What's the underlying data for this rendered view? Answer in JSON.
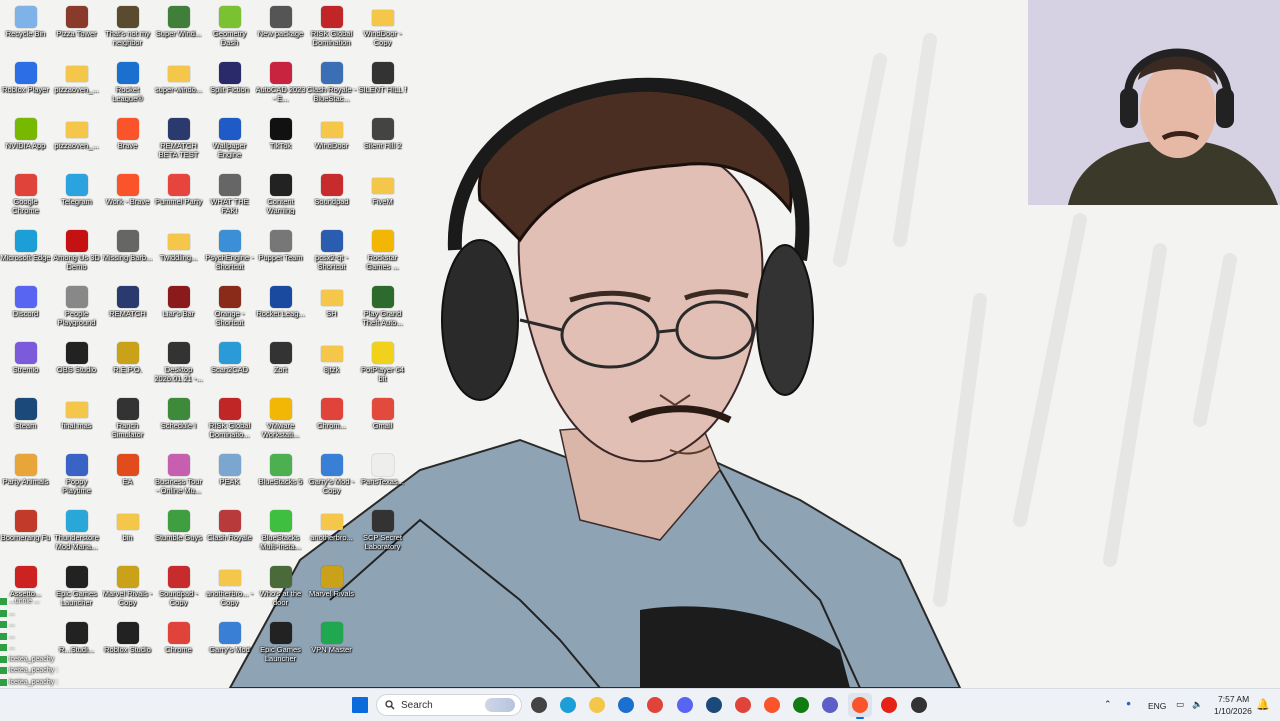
{
  "desktop": {
    "icons": [
      {
        "label": "Recycle Bin",
        "icon": "recycle-bin-icon",
        "color": "#7fb2e6"
      },
      {
        "label": "Pizza Tower",
        "icon": "pizza-tower-icon",
        "color": "#8a3a2a"
      },
      {
        "label": "That's not my neighbor",
        "icon": "neighbor-game-icon",
        "color": "#5a4a2e"
      },
      {
        "label": "Super Wind...",
        "icon": "game-icon",
        "color": "#3f7f3a"
      },
      {
        "label": "Geometry Dash",
        "icon": "geometry-dash-icon",
        "color": "#7ac231"
      },
      {
        "label": "New package",
        "icon": "package-icon",
        "color": "#555"
      },
      {
        "label": "RISK Global Domination",
        "icon": "risk-icon",
        "color": "#c02626"
      },
      {
        "label": "WindDoor - Copy",
        "icon": "folder-icon",
        "color": "#f4c64a",
        "folder": true
      },
      {
        "label": "Roblox Player",
        "icon": "roblox-icon",
        "color": "#2b6ee6"
      },
      {
        "label": "pizzaoven_...",
        "icon": "folder-icon",
        "color": "#f4c64a",
        "folder": true
      },
      {
        "label": "Rocket League®",
        "icon": "rocket-league-icon",
        "color": "#1a6fcf"
      },
      {
        "label": "super-windo...",
        "icon": "folder-icon",
        "color": "#f4c64a",
        "folder": true
      },
      {
        "label": "Split Fiction",
        "icon": "split-fiction-icon",
        "color": "#2a2a6a"
      },
      {
        "label": "AutoCAD 2023 - E...",
        "icon": "autocad-icon",
        "color": "#c9243f"
      },
      {
        "label": "Clash Royale - BlueStac...",
        "icon": "clash-royale-icon",
        "color": "#3b6fb5"
      },
      {
        "label": "SILENT HILL f",
        "icon": "silent-hill-icon",
        "color": "#333"
      },
      {
        "label": "NVIDIA App",
        "icon": "nvidia-icon",
        "color": "#76b900"
      },
      {
        "label": "pizzaoven_...",
        "icon": "folder-icon",
        "color": "#f4c64a",
        "folder": true
      },
      {
        "label": "Brave",
        "icon": "brave-icon",
        "color": "#fb542b"
      },
      {
        "label": "REMATCH BETA TEST",
        "icon": "rematch-icon",
        "color": "#2b3a6e"
      },
      {
        "label": "Wallpaper Engine",
        "icon": "wallpaper-engine-icon",
        "color": "#1e5bc6"
      },
      {
        "label": "TikTok",
        "icon": "tiktok-icon",
        "color": "#111"
      },
      {
        "label": "WindDoor",
        "icon": "folder-icon",
        "color": "#f4c64a",
        "folder": true
      },
      {
        "label": "Silent Hill 2",
        "icon": "silent-hill-2-icon",
        "color": "#444"
      },
      {
        "label": "Google Chrome",
        "icon": "chrome-icon",
        "color": "#e0433a"
      },
      {
        "label": "Telegram",
        "icon": "telegram-icon",
        "color": "#2aa3df"
      },
      {
        "label": "Work - Brave",
        "icon": "brave-work-icon",
        "color": "#fb542b"
      },
      {
        "label": "Pummel Party",
        "icon": "pummel-party-icon",
        "color": "#e7443e"
      },
      {
        "label": "WHAT THE FAK!",
        "icon": "game-icon",
        "color": "#666"
      },
      {
        "label": "Content Warning",
        "icon": "content-warning-icon",
        "color": "#222"
      },
      {
        "label": "Soundpad",
        "icon": "soundpad-icon",
        "color": "#c82b2b"
      },
      {
        "label": "FiveM",
        "icon": "folder-icon",
        "color": "#f4c64a",
        "folder": true
      },
      {
        "label": "Microsoft Edge",
        "icon": "edge-icon",
        "color": "#1b9fd6"
      },
      {
        "label": "Among Us 3D Demo",
        "icon": "among-us-icon",
        "color": "#c51111"
      },
      {
        "label": "Missing Barb...",
        "icon": "game-icon",
        "color": "#666"
      },
      {
        "label": "Twiddling...",
        "icon": "folder-icon",
        "color": "#f4c64a",
        "folder": true
      },
      {
        "label": "PsychEngine - Shortcut",
        "icon": "psych-engine-icon",
        "color": "#3a8fd6"
      },
      {
        "label": "Puppet Team",
        "icon": "game-icon",
        "color": "#777"
      },
      {
        "label": "pcsx2-qt - Shortcut",
        "icon": "pcsx2-icon",
        "color": "#2a5db0"
      },
      {
        "label": "Rockstar Games ...",
        "icon": "rockstar-icon",
        "color": "#f2b705"
      },
      {
        "label": "Discord",
        "icon": "discord-icon",
        "color": "#5865f2"
      },
      {
        "label": "People Playground",
        "icon": "people-playground-icon",
        "color": "#888"
      },
      {
        "label": "REMATCH",
        "icon": "rematch-icon",
        "color": "#2b3a6e"
      },
      {
        "label": "Liar's Bar",
        "icon": "liars-bar-icon",
        "color": "#8b1a1a"
      },
      {
        "label": "Orange - Shortcut",
        "icon": "orange-icon",
        "color": "#8a2b1a"
      },
      {
        "label": "Rocket Leag...",
        "icon": "rocket-league-icon",
        "color": "#1a4a9f"
      },
      {
        "label": "SH",
        "icon": "folder-icon",
        "color": "#f4c64a",
        "folder": true
      },
      {
        "label": "Play Grand Theft Auto...",
        "icon": "gta-icon",
        "color": "#2d6b2d"
      },
      {
        "label": "Stremio",
        "icon": "stremio-icon",
        "color": "#7b5bdc"
      },
      {
        "label": "OBS Studio",
        "icon": "obs-icon",
        "color": "#222"
      },
      {
        "label": "R.E.P.O.",
        "icon": "repo-icon",
        "color": "#c9a21a"
      },
      {
        "label": "Desktop 2026.01.21 -...",
        "icon": "video-icon",
        "color": "#333"
      },
      {
        "label": "Scan2CAD",
        "icon": "scan2cad-icon",
        "color": "#2a9bd6"
      },
      {
        "label": "Zort",
        "icon": "zort-icon",
        "color": "#333"
      },
      {
        "label": "8jtzk",
        "icon": "folder-icon",
        "color": "#f4c64a",
        "folder": true
      },
      {
        "label": "PotPlayer 64 bit",
        "icon": "potplayer-icon",
        "color": "#f0d21c"
      },
      {
        "label": "Steam",
        "icon": "steam-icon",
        "color": "#1b4a7a"
      },
      {
        "label": "final.mas",
        "icon": "folder-icon",
        "color": "#f4c64a",
        "folder": true
      },
      {
        "label": "Ranch Simulator",
        "icon": "ranch-simulator-icon",
        "color": "#333"
      },
      {
        "label": "Schedule I",
        "icon": "schedule-icon",
        "color": "#3d8a3a"
      },
      {
        "label": "RISK Global Dominatio...",
        "icon": "risk-icon",
        "color": "#c02626"
      },
      {
        "label": "VMware Workstati...",
        "icon": "vmware-icon",
        "color": "#f2b705"
      },
      {
        "label": "Chrom...",
        "icon": "chrome-icon",
        "color": "#e0433a"
      },
      {
        "label": "Gmail",
        "icon": "gmail-icon",
        "color": "#e24a3b"
      },
      {
        "label": "Party Animals",
        "icon": "party-animals-icon",
        "color": "#e8a53a"
      },
      {
        "label": "Poppy Playtime",
        "icon": "poppy-playtime-icon",
        "color": "#3a63c6"
      },
      {
        "label": "EA",
        "icon": "ea-icon",
        "color": "#e24b1c"
      },
      {
        "label": "Business Tour - Online Mu...",
        "icon": "business-tour-icon",
        "color": "#c75fb1"
      },
      {
        "label": "PEAK",
        "icon": "peak-icon",
        "color": "#7aa6cf"
      },
      {
        "label": "BlueStacks 5",
        "icon": "bluestacks-icon",
        "color": "#4caf50"
      },
      {
        "label": "Garry's Mod - Copy",
        "icon": "garrys-mod-icon",
        "color": "#3a7fd6"
      },
      {
        "label": "ParisTexas...",
        "icon": "srt-file-icon",
        "color": "#eee"
      },
      {
        "label": "Boomerang Fu",
        "icon": "boomerang-fu-icon",
        "color": "#c23a2a"
      },
      {
        "label": "Thunderstore Mod Mana...",
        "icon": "thunderstore-icon",
        "color": "#29a7d8"
      },
      {
        "label": "bin",
        "icon": "folder-icon",
        "color": "#f4c64a",
        "folder": true
      },
      {
        "label": "Stumble Guys",
        "icon": "stumble-guys-icon",
        "color": "#3f9e3f"
      },
      {
        "label": "Clash Royale",
        "icon": "clash-royale-icon",
        "color": "#b83a3a"
      },
      {
        "label": "BlueStacks Multi-Insta...",
        "icon": "bluestacks-multi-icon",
        "color": "#3fbf3f"
      },
      {
        "label": "anotherbro...",
        "icon": "folder-icon",
        "color": "#f4c64a",
        "folder": true
      },
      {
        "label": "SCP Secret Laboratory",
        "icon": "scp-icon",
        "color": "#333"
      },
      {
        "label": "Assetto...",
        "icon": "game-icon",
        "color": "#c22"
      },
      {
        "label": "Epic Games Launcher",
        "icon": "epic-games-icon",
        "color": "#222"
      },
      {
        "label": "Marvel Rivals - Copy",
        "icon": "marvel-rivals-icon",
        "color": "#c9a21a"
      },
      {
        "label": "Soundpad - Copy",
        "icon": "soundpad-icon",
        "color": "#c82b2b"
      },
      {
        "label": "anotherbro... - Copy",
        "icon": "folder-icon",
        "color": "#f4c64a",
        "folder": true
      },
      {
        "label": "Who's at the door",
        "icon": "game-icon",
        "color": "#4a6a3a"
      },
      {
        "label": "Marvel Rivals",
        "icon": "marvel-rivals-icon",
        "color": "#c9a21a"
      },
      {
        "label": "",
        "icon": "",
        "color": ""
      },
      {
        "label": "",
        "icon": "",
        "color": ""
      },
      {
        "label": "R...Studi...",
        "icon": "roblox-studio-icon",
        "color": "#222"
      },
      {
        "label": "Roblox Studio",
        "icon": "roblox-studio-icon",
        "color": "#222"
      },
      {
        "label": "Chrome",
        "icon": "chrome-icon",
        "color": "#e0433a"
      },
      {
        "label": "Garry's Mod",
        "icon": "garrys-mod-icon",
        "color": "#3a7fd6"
      },
      {
        "label": "Epic Games Launcher",
        "icon": "epic-games-icon",
        "color": "#222"
      },
      {
        "label": "VPN Master",
        "icon": "vpn-icon",
        "color": "#1fa84f"
      },
      {
        "label": "",
        "icon": "",
        "color": ""
      }
    ]
  },
  "chat": {
    "lines": [
      {
        "user": "...unnie ...",
        "msg": ""
      },
      {
        "user": "...",
        "msg": ""
      },
      {
        "user": "...",
        "msg": ""
      },
      {
        "user": "...",
        "msg": ""
      },
      {
        "user": "...",
        "msg": ""
      },
      {
        "user": "icetea_peachy",
        "msg": ""
      },
      {
        "user": "icetea_peachy :",
        "msg": ""
      },
      {
        "user": "icetea_peachy :",
        "msg": ""
      }
    ]
  },
  "taskbar": {
    "search_placeholder": "Search",
    "pinned": [
      {
        "name": "start-button",
        "icon": "windows-icon",
        "color": "#0a6cdc"
      },
      {
        "name": "task-view-button",
        "icon": "task-view-icon",
        "color": "#444"
      },
      {
        "name": "edge-taskbar",
        "icon": "edge-icon",
        "color": "#1b9fd6"
      },
      {
        "name": "file-explorer-taskbar",
        "icon": "folder-icon",
        "color": "#f4c64a"
      },
      {
        "name": "outlook-taskbar",
        "icon": "mail-icon",
        "color": "#1a6fcf"
      },
      {
        "name": "chrome-taskbar",
        "icon": "chrome-icon",
        "color": "#e0433a"
      },
      {
        "name": "discord-taskbar",
        "icon": "discord-icon",
        "color": "#5865f2"
      },
      {
        "name": "steam-taskbar",
        "icon": "steam-icon",
        "color": "#1b4a7a"
      },
      {
        "name": "vpn-taskbar",
        "icon": "vpn-icon",
        "color": "#e0433a"
      },
      {
        "name": "brave-taskbar",
        "icon": "brave-icon",
        "color": "#fb542b"
      },
      {
        "name": "xbox-taskbar",
        "icon": "xbox-icon",
        "color": "#107c10"
      },
      {
        "name": "teams-taskbar",
        "icon": "teams-icon",
        "color": "#5b5fc7"
      },
      {
        "name": "brave-active-taskbar",
        "icon": "brave-icon",
        "color": "#fb542b"
      },
      {
        "name": "youtube-taskbar",
        "icon": "youtube-icon",
        "color": "#e62117"
      },
      {
        "name": "obs-taskbar",
        "icon": "obs-icon",
        "color": "#333"
      }
    ],
    "tray": {
      "language": "ENG",
      "time": "7:57 AM",
      "date": "1/10/2026"
    }
  }
}
